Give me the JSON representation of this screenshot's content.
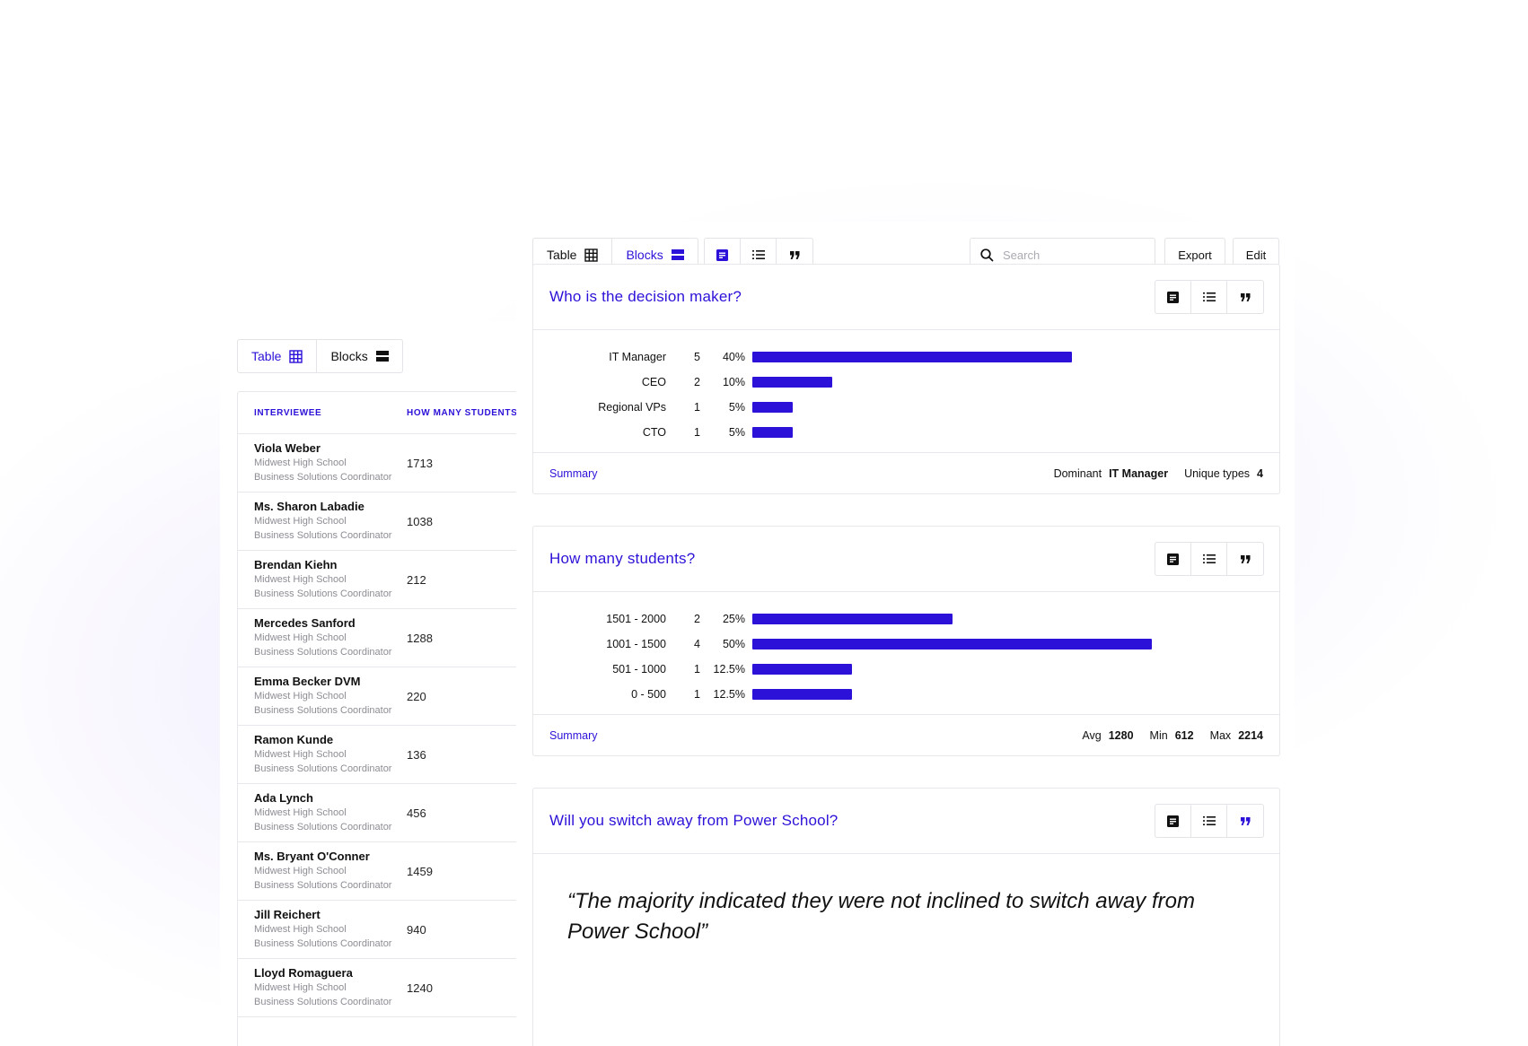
{
  "colors": {
    "accent": "#2c12d8",
    "border": "#e6e6eb"
  },
  "left": {
    "toggle": {
      "table_label": "Table",
      "blocks_label": "Blocks",
      "active": "table"
    },
    "columns": [
      "INTERVIEWEE",
      "HOW MANY STUDENTS?"
    ],
    "rows": [
      {
        "name": "Viola Weber",
        "school": "Midwest High School",
        "role": "Business Solutions Coordinator",
        "value": "1713"
      },
      {
        "name": "Ms. Sharon Labadie",
        "school": "Midwest High School",
        "role": "Business Solutions Coordinator",
        "value": "1038"
      },
      {
        "name": "Brendan Kiehn",
        "school": "Midwest High School",
        "role": "Business Solutions Coordinator",
        "value": "212"
      },
      {
        "name": "Mercedes Sanford",
        "school": "Midwest High School",
        "role": "Business Solutions Coordinator",
        "value": "1288"
      },
      {
        "name": "Emma Becker DVM",
        "school": "Midwest High School",
        "role": "Business Solutions Coordinator",
        "value": "220"
      },
      {
        "name": "Ramon Kunde",
        "school": "Midwest High School",
        "role": "Business Solutions Coordinator",
        "value": "136"
      },
      {
        "name": "Ada Lynch",
        "school": "Midwest High School",
        "role": "Business Solutions Coordinator",
        "value": "456"
      },
      {
        "name": "Ms. Bryant O'Conner",
        "school": "Midwest High School",
        "role": "Business Solutions Coordinator",
        "value": "1459"
      },
      {
        "name": "Jill Reichert",
        "school": "Midwest High School",
        "role": "Business Solutions Coordinator",
        "value": "940"
      },
      {
        "name": "Lloyd Romaguera",
        "school": "Midwest High School",
        "role": "Business Solutions Coordinator",
        "value": "1240"
      }
    ]
  },
  "right": {
    "toggle": {
      "table_label": "Table",
      "blocks_label": "Blocks",
      "active": "blocks"
    },
    "view_icons": [
      "summary-icon",
      "list-icon",
      "quote-icon"
    ],
    "search": {
      "placeholder": "Search",
      "value": ""
    },
    "export_label": "Export",
    "edit_label": "Edit",
    "q1": {
      "title": "Who is the decision maker?",
      "rows": [
        {
          "label": "IT Manager",
          "count": "5",
          "pct": "40%",
          "fraction": 0.4
        },
        {
          "label": "CEO",
          "count": "2",
          "pct": "10%",
          "fraction": 0.1
        },
        {
          "label": "Regional VPs",
          "count": "1",
          "pct": "5%",
          "fraction": 0.05
        },
        {
          "label": "CTO",
          "count": "1",
          "pct": "5%",
          "fraction": 0.05
        }
      ],
      "summary_label": "Summary",
      "stats": [
        {
          "key": "Dominant",
          "value": "IT Manager"
        },
        {
          "key": "Unique types",
          "value": "4"
        }
      ]
    },
    "q2": {
      "title": "How many students?",
      "rows": [
        {
          "label": "1501 - 2000",
          "count": "2",
          "pct": "25%",
          "fraction": 0.25
        },
        {
          "label": "1001 - 1500",
          "count": "4",
          "pct": "50%",
          "fraction": 0.5
        },
        {
          "label": "501 - 1000",
          "count": "1",
          "pct": "12.5%",
          "fraction": 0.125
        },
        {
          "label": "0 - 500",
          "count": "1",
          "pct": "12.5%",
          "fraction": 0.125
        }
      ],
      "summary_label": "Summary",
      "stats": [
        {
          "key": "Avg",
          "value": "1280"
        },
        {
          "key": "Min",
          "value": "612"
        },
        {
          "key": "Max",
          "value": "2214"
        }
      ]
    },
    "q3": {
      "title": "Will you switch away from Power School?",
      "quote": "“The majority indicated they were not inclined to switch away from Power School”"
    }
  }
}
